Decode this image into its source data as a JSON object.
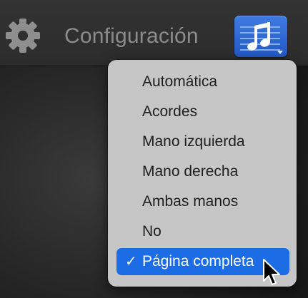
{
  "toolbar": {
    "title": "Configuración",
    "settings_icon": "gear-icon",
    "view_button_icon": "music-notes-icon"
  },
  "menu": {
    "items": [
      {
        "label": "Automática",
        "selected": false
      },
      {
        "label": "Acordes",
        "selected": false
      },
      {
        "label": "Mano izquierda",
        "selected": false
      },
      {
        "label": "Mano derecha",
        "selected": false
      },
      {
        "label": "Ambas manos",
        "selected": false
      },
      {
        "label": "No",
        "selected": false
      },
      {
        "label": "Página completa",
        "selected": true
      }
    ],
    "check_mark": "✓"
  },
  "colors": {
    "accent": "#1c6ce6",
    "menu_background": "#c6c6c6",
    "toolbar_background": "#2e2e2e"
  }
}
